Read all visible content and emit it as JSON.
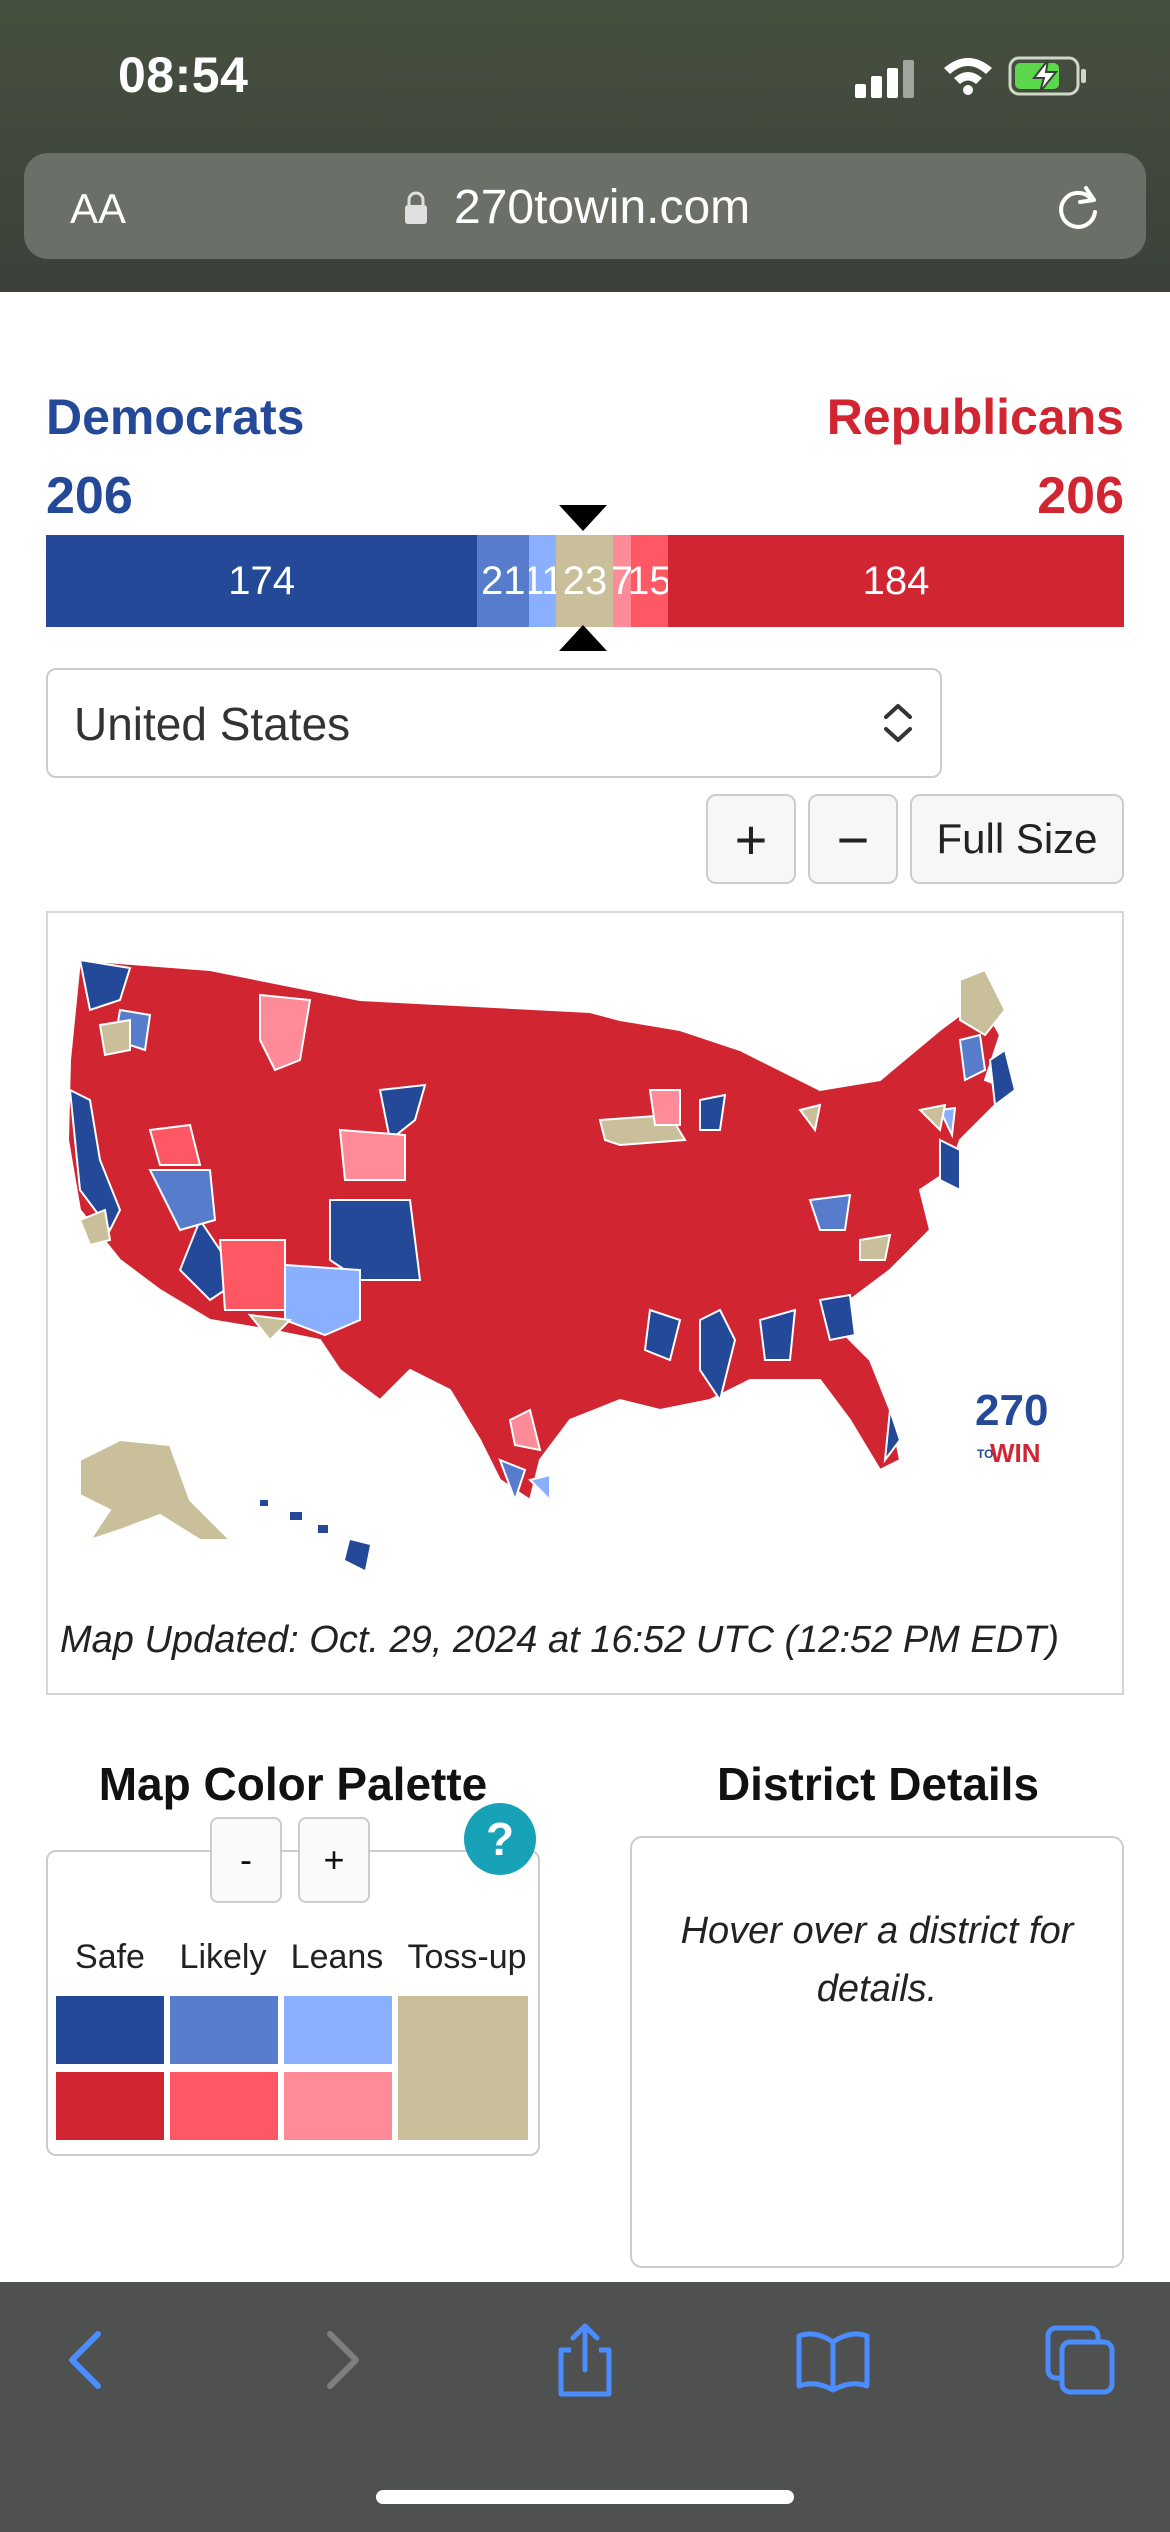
{
  "status_bar": {
    "time": "08:54"
  },
  "browser": {
    "text_size_label": "AA",
    "url": "270towin.com"
  },
  "summary": {
    "dem_label": "Democrats",
    "dem_total": "206",
    "rep_label": "Republicans",
    "rep_total": "206"
  },
  "ev_bar": [
    {
      "key": "dem-safe",
      "value": 174,
      "label": "174",
      "color": "#244999"
    },
    {
      "key": "dem-likely",
      "value": 21,
      "label": "21",
      "color": "#577ccc"
    },
    {
      "key": "dem-leans",
      "value": 11,
      "label": "11",
      "color": "#8aafff"
    },
    {
      "key": "tossup",
      "value": 23,
      "label": "23",
      "color": "#c9c09b"
    },
    {
      "key": "rep-leans",
      "value": 7,
      "label": "7",
      "color": "#ff8b98"
    },
    {
      "key": "rep-likely",
      "value": 15,
      "label": "15",
      "color": "#ff5865"
    },
    {
      "key": "rep-safe",
      "value": 184,
      "label": "184",
      "color": "#d22532"
    }
  ],
  "country_select": {
    "value": "United States"
  },
  "map_controls": {
    "zoom_in": "+",
    "zoom_out": "−",
    "full_size": "Full Size"
  },
  "map": {
    "logo_top": "270",
    "logo_to": "TO",
    "logo_win": "WIN",
    "updated": "Map Updated: Oct. 29, 2024 at 16:52 UTC (12:52 PM EDT)"
  },
  "palette": {
    "title": "Map Color Palette",
    "minus": "-",
    "plus": "+",
    "help": "?",
    "headers": [
      "Safe",
      "Likely",
      "Leans",
      "Toss-up"
    ],
    "colors": {
      "dem_safe": "#244999",
      "dem_likely": "#577ccc",
      "dem_leans": "#8aafff",
      "rep_safe": "#d22532",
      "rep_likely": "#ff5865",
      "rep_leans": "#ff8b98",
      "tossup": "#c9c09b"
    }
  },
  "district": {
    "title": "District Details",
    "hint": "Hover over a district for details."
  },
  "toolbar_icons": [
    "back-icon",
    "forward-icon",
    "share-icon",
    "bookmarks-icon",
    "tabs-icon"
  ]
}
